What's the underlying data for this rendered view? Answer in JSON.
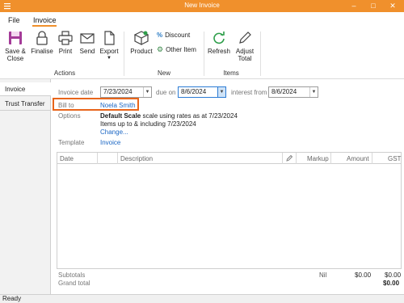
{
  "window": {
    "title": "New Invoice"
  },
  "menu": {
    "file": "File",
    "invoice": "Invoice"
  },
  "ribbon": {
    "save_close": [
      "Save &",
      "Close"
    ],
    "finalise": "Finalise",
    "print": "Print",
    "send": "Send",
    "export": "Export",
    "product": "Product",
    "discount": "Discount",
    "other_item": "Other Item",
    "refresh": "Refresh",
    "adjust_total": [
      "Adjust",
      "Total"
    ],
    "groups": {
      "actions": "Actions",
      "new": "New",
      "items": "Items"
    }
  },
  "left_tabs": {
    "invoice": "Invoice",
    "trust_transfer": "Trust Transfer"
  },
  "form": {
    "invoice_date_label": "Invoice date",
    "invoice_date": "7/23/2024",
    "due_on_label": "due on",
    "due_on": "8/6/2024",
    "interest_from_label": "interest from",
    "interest_from": "8/6/2024",
    "bill_to_label": "Bill to",
    "bill_to": "Noela Smith",
    "options_label": "Options",
    "options_scale_bold": "Default Scale",
    "options_scale_rest": " scale using rates as at ",
    "options_scale_date": "7/23/2024",
    "options_items_text": "Items up to & including ",
    "options_items_date": "7/23/2024",
    "change_link": "Change...",
    "template_label": "Template",
    "template_value": "Invoice"
  },
  "grid": {
    "columns": {
      "date": "Date",
      "description": "Description",
      "markup": "Markup",
      "amount": "Amount",
      "gst": "GST"
    }
  },
  "totals": {
    "subtotals_label": "Subtotals",
    "markup": "Nil",
    "amount": "$0.00",
    "gst": "$0.00",
    "grand_total_label": "Grand total",
    "grand_total": "$0.00"
  },
  "status": {
    "text": "Ready"
  },
  "colors": {
    "accent": "#f0902c",
    "highlight": "#e8651b",
    "link": "#1a66c4"
  }
}
